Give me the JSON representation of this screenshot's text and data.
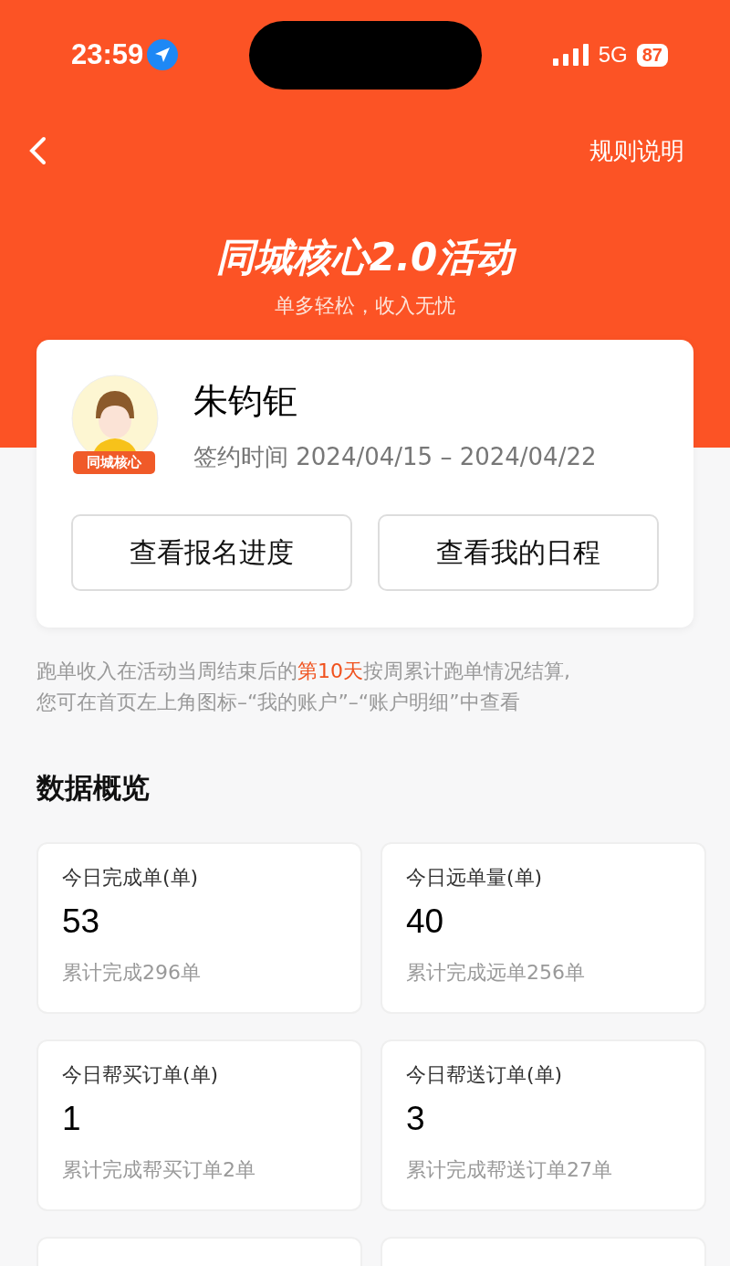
{
  "status_bar": {
    "time": "23:59",
    "network": "5G",
    "battery": "87"
  },
  "nav": {
    "right_link": "规则说明"
  },
  "banner": {
    "title": "同城核心2.0活动",
    "subtitle": "单多轻松，收入无忧"
  },
  "profile": {
    "name": "朱钧钜",
    "badge": "同城核心",
    "sign_label": "签约时间",
    "sign_period": "2024/04/15 – 2024/04/22",
    "buttons": [
      "查看报名进度",
      "查看我的日程"
    ]
  },
  "notice": {
    "before": "跑单收入在活动当周结束后的",
    "highlight": "第10天",
    "after": "按周累计跑单情况结算,",
    "second_line": "您可在首页左上角图标–“我的账户”–“账户明细”中查看"
  },
  "overview": {
    "title": "数据概览",
    "cards": [
      {
        "label": "今日完成单(单)",
        "value": "53",
        "note": "累计完成296单"
      },
      {
        "label": "今日远单量(单)",
        "value": "40",
        "note": "累计完成远单256单"
      },
      {
        "label": "今日帮买订单(单)",
        "value": "1",
        "note": "累计完成帮买订单2单"
      },
      {
        "label": "今日帮送订单(单)",
        "value": "3",
        "note": "累计完成帮送订单27单"
      }
    ],
    "more_cards_below": true
  }
}
